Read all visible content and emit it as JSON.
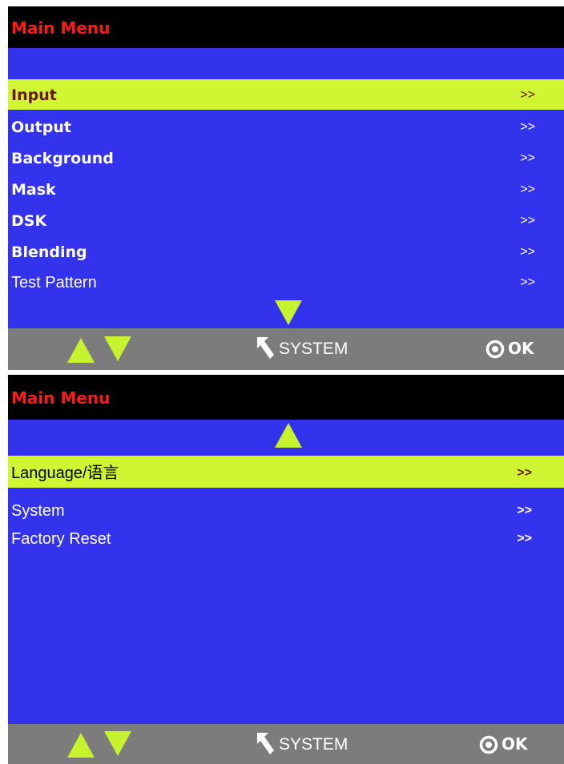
{
  "screens": [
    {
      "title": "Main Menu",
      "items": [
        {
          "label": "Input",
          "arrow": ">>"
        },
        {
          "label": "Output",
          "arrow": ">>"
        },
        {
          "label": "Background",
          "arrow": ">>"
        },
        {
          "label": "Mask",
          "arrow": ">>"
        },
        {
          "label": "DSK",
          "arrow": ">>"
        },
        {
          "label": "Blending",
          "arrow": ">>"
        },
        {
          "label": "Test Pattern",
          "arrow": ">>"
        }
      ],
      "selected_index": 0,
      "scroll_indicator": "scroll-down-icon",
      "bottom_bar": {
        "system_label": "SYSTEM",
        "ok_label": "OK",
        "nav_icons": [
          "arrow-up-icon",
          "arrow-down-icon"
        ]
      }
    },
    {
      "title": "Main Menu",
      "items": [
        {
          "label": "Language/语言",
          "arrow": ">>"
        },
        {
          "label": "System",
          "arrow": ">>"
        },
        {
          "label": "Factory Reset",
          "arrow": ">>"
        }
      ],
      "selected_index": 0,
      "scroll_indicator": "scroll-up-icon",
      "bottom_bar": {
        "system_label": "SYSTEM",
        "ok_label": "OK",
        "nav_icons": [
          "arrow-up-icon",
          "arrow-down-icon"
        ]
      }
    }
  ],
  "colors": {
    "screen_bg": "#3333ee",
    "title_bar_bg": "#000000",
    "title_text": "#ff1a1a",
    "highlight_bg": "#d0f533",
    "highlight_text": "#6b1a0a",
    "bottom_bar_bg": "#7c7c7c",
    "nav_arrow": "#c7f22e"
  }
}
